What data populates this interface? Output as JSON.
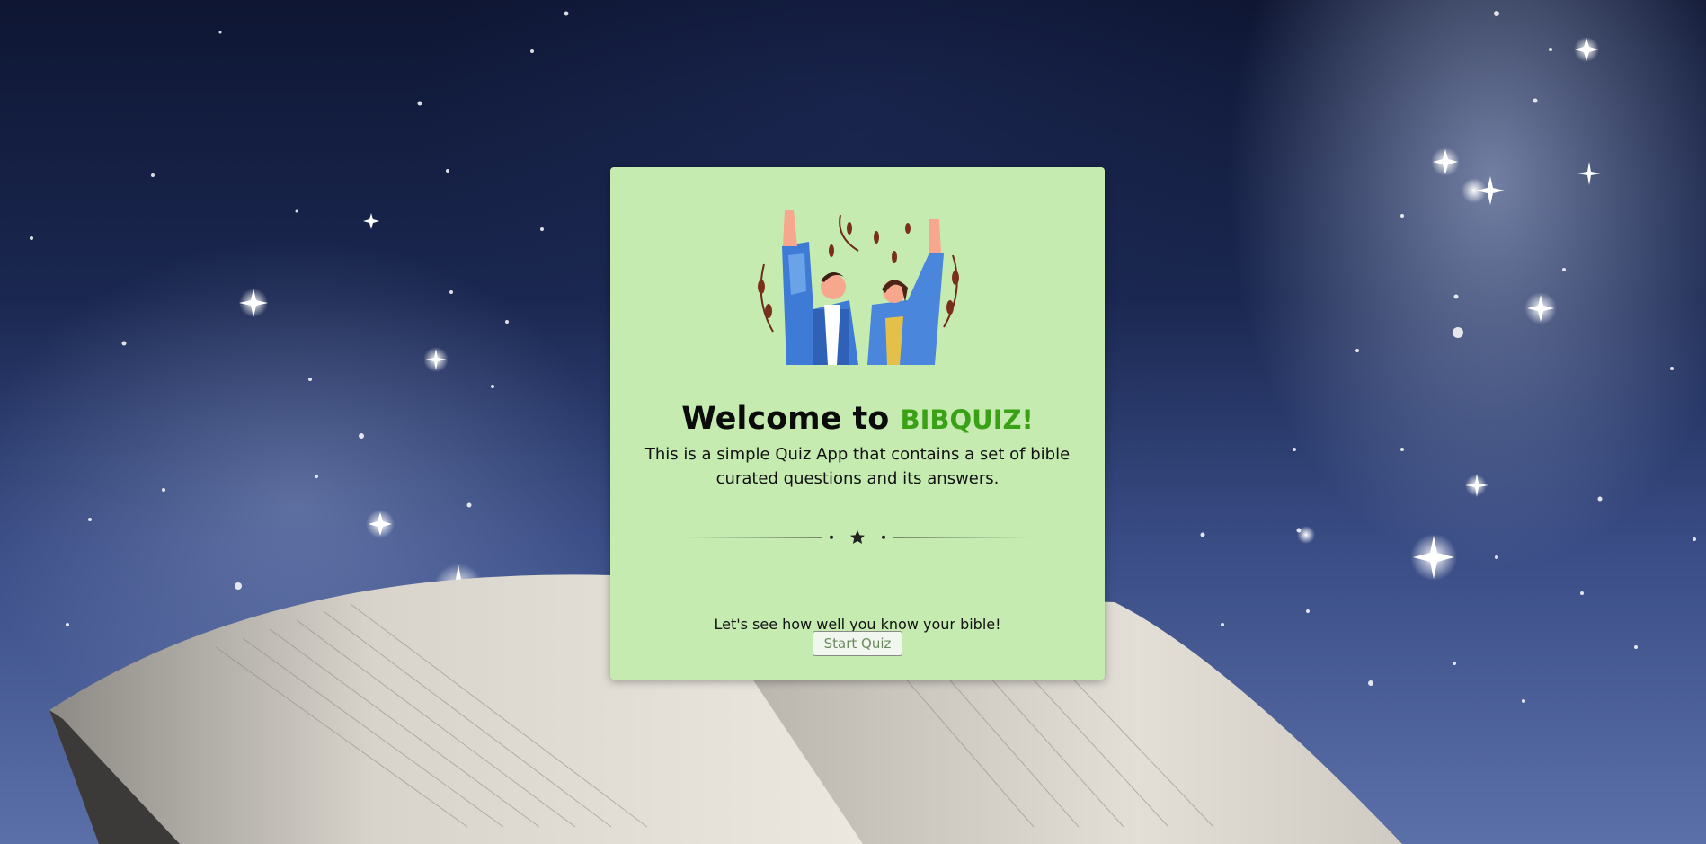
{
  "app": {
    "welcome_prefix": "Welcome to ",
    "brand_name": "BIBQUIZ!",
    "description": "This is a simple Quiz App that contains a set of bible curated questions and its answers.",
    "prompt": "Let's see how well you know your bible!",
    "start_button_label": "Start Quiz"
  },
  "colors": {
    "card_background": "#c5ebb1",
    "brand_green": "#3aa116",
    "button_text": "#6b8a5f"
  },
  "icons": {
    "hero": "celebrating-people-illustration",
    "divider": "star-divider-icon"
  }
}
